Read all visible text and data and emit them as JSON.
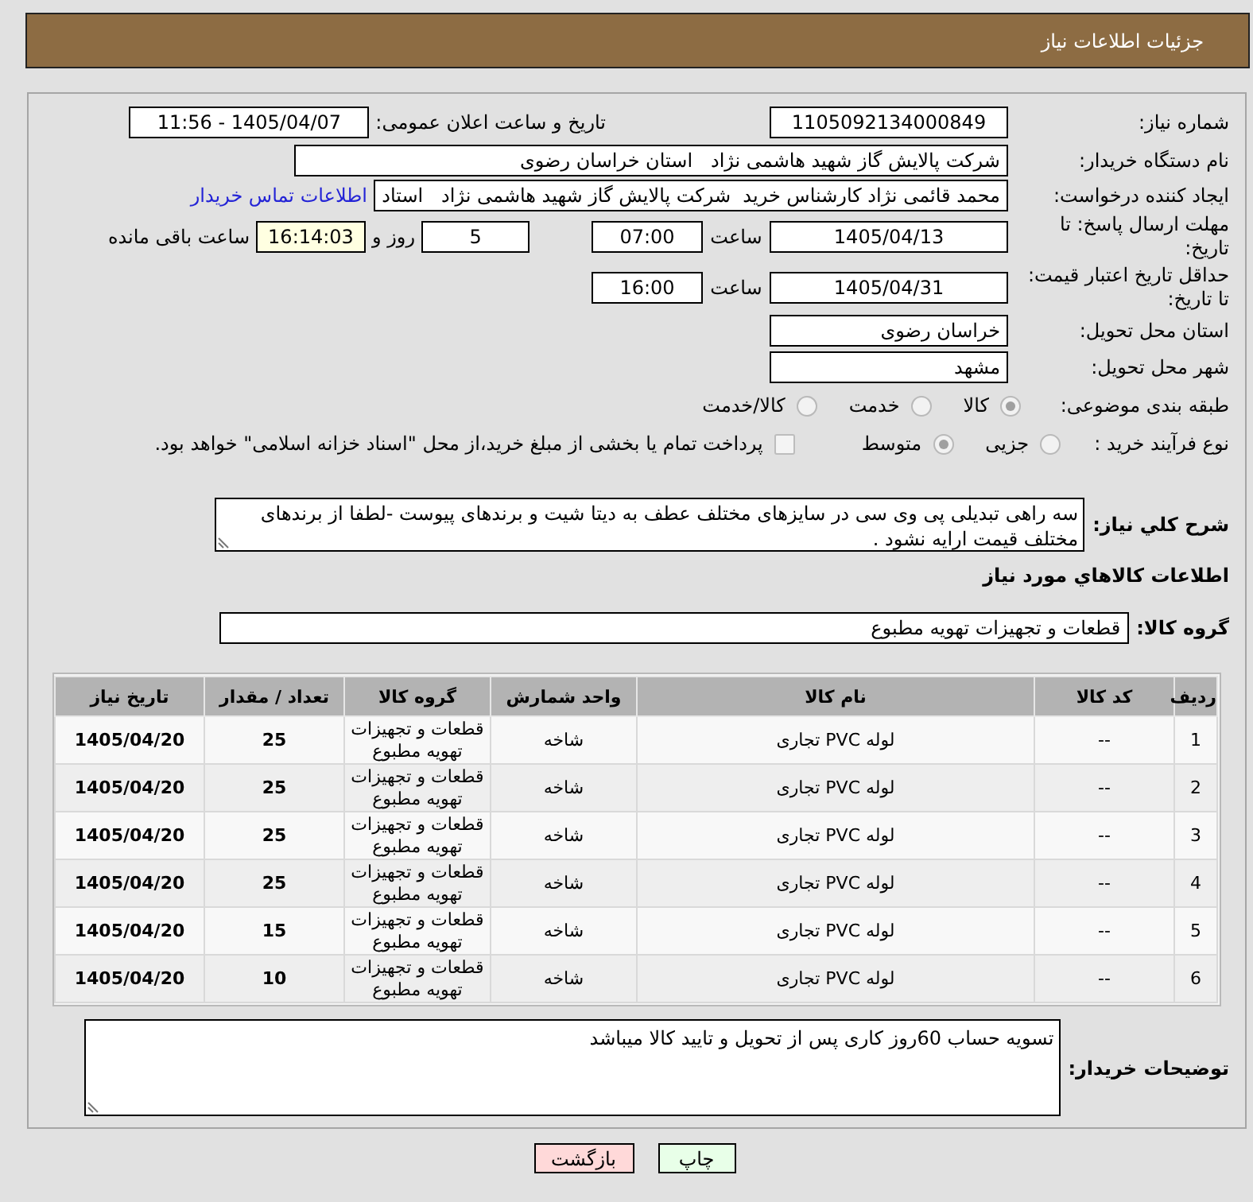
{
  "header": {
    "title": "جزئیات اطلاعات نیاز"
  },
  "details": {
    "need_number": {
      "label": "شماره نیاز:",
      "value": "1105092134000849"
    },
    "announcement": {
      "label": "تاریخ و ساعت اعلان عمومی:",
      "value": "1405/04/07 - 11:56"
    },
    "buyer_org": {
      "label": "نام دستگاه خریدار:",
      "value": "شرکت پالایش گاز شهید هاشمی نژاد   استان خراسان رضوی"
    },
    "requester": {
      "label": "ایجاد کننده درخواست:",
      "value": "محمد قائمی نژاد کارشناس خرید  شرکت پالایش گاز شهید هاشمی نژاد   استاد",
      "contact_link": "اطلاعات تماس خریدار"
    },
    "response_deadline": {
      "label": "مهلت ارسال پاسخ: تا تاریخ:",
      "date": "1405/04/13",
      "time_label": "ساعت",
      "time": "07:00",
      "days": "5",
      "days_label": "روز و",
      "remaining": "16:14:03",
      "remaining_label": "ساعت باقی مانده"
    },
    "price_validity": {
      "label": "حداقل تاریخ اعتبار قیمت: تا تاریخ:",
      "date": "1405/04/31",
      "time_label": "ساعت",
      "time": "16:00"
    },
    "delivery_province": {
      "label": "استان محل تحویل:",
      "value": "خراسان رضوی"
    },
    "delivery_city": {
      "label": "شهر محل تحویل:",
      "value": "مشهد"
    },
    "subject_category": {
      "label": "طبقه بندی موضوعی:",
      "options": [
        {
          "label": "کالا",
          "selected": true
        },
        {
          "label": "خدمت",
          "selected": false
        },
        {
          "label": "کالا/خدمت",
          "selected": false
        }
      ]
    },
    "purchase_process": {
      "label": "نوع فرآیند خرید :",
      "options": [
        {
          "label": "جزیی",
          "selected": false
        },
        {
          "label": "متوسط",
          "selected": true
        }
      ],
      "treasury_payment": {
        "label": "پرداخت تمام یا بخشی از مبلغ خرید،از محل \"اسناد خزانه اسلامی\" خواهد بود.",
        "checked": false
      }
    }
  },
  "description": {
    "label": "شرح کلي نياز:",
    "value": "سه راهی تبدیلی پی وی سی در سایزهای مختلف عطف به دیتا شیت و برندهای پیوست -لطفا از برندهای مختلف قیمت ارایه نشود ."
  },
  "goods": {
    "title": "اطلاعات کالاهاي مورد نياز",
    "group": {
      "label": "گروه کالا:",
      "value": "قطعات و تجهیزات تهویه مطبوع"
    },
    "table": {
      "columns": [
        "ردیف",
        "کد کالا",
        "نام کالا",
        "واحد شمارش",
        "گروه کالا",
        "تعداد / مقدار",
        "تاریخ نیاز"
      ],
      "rows": [
        [
          "1",
          "--",
          "لوله PVC تجاری",
          "شاخه",
          "قطعات و تجهیزات تهویه مطبوع",
          "25",
          "1405/04/20"
        ],
        [
          "2",
          "--",
          "لوله PVC تجاری",
          "شاخه",
          "قطعات و تجهیزات تهویه مطبوع",
          "25",
          "1405/04/20"
        ],
        [
          "3",
          "--",
          "لوله PVC تجاری",
          "شاخه",
          "قطعات و تجهیزات تهویه مطبوع",
          "25",
          "1405/04/20"
        ],
        [
          "4",
          "--",
          "لوله PVC تجاری",
          "شاخه",
          "قطعات و تجهیزات تهویه مطبوع",
          "25",
          "1405/04/20"
        ],
        [
          "5",
          "--",
          "لوله PVC تجاری",
          "شاخه",
          "قطعات و تجهیزات تهویه مطبوع",
          "15",
          "1405/04/20"
        ],
        [
          "6",
          "--",
          "لوله PVC تجاری",
          "شاخه",
          "قطعات و تجهیزات تهویه مطبوع",
          "10",
          "1405/04/20"
        ]
      ]
    }
  },
  "buyer_notes": {
    "label": "توضیحات خریدار:",
    "value": "تسویه حساب 60روز کاری پس از تحویل و تایید کالا میباشد"
  },
  "buttons": [
    {
      "label": "چاپ",
      "kind": "print"
    },
    {
      "label": "بازگشت",
      "kind": "back"
    }
  ]
}
